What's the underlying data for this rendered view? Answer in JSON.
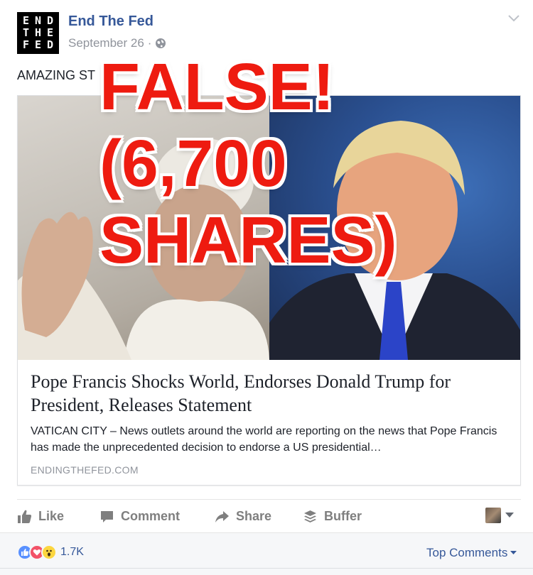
{
  "page": {
    "logo_letters": [
      "E",
      "N",
      "D",
      "T",
      "H",
      "E",
      "F",
      "E",
      "D"
    ],
    "name": "End The Fed",
    "date": "September 26",
    "separator": "·"
  },
  "post": {
    "text": "AMAZING ST"
  },
  "link_card": {
    "headline": "Pope Francis Shocks World, Endorses Donald Trump for President, Releases Statement",
    "description": "VATICAN CITY – News outlets around the world are reporting on the news that Pope Francis has made the unprecedented decision to endorse a US presidential…",
    "domain": "ENDINGTHEFED.COM"
  },
  "overlay": {
    "line1": "FALSE!",
    "line2": "(6,700",
    "line3": "SHARES)",
    "color": "#ee1b10"
  },
  "actions": {
    "like": "Like",
    "comment": "Comment",
    "share": "Share",
    "buffer": "Buffer"
  },
  "footer": {
    "reactions": [
      "like-icon",
      "love-icon",
      "wow-icon"
    ],
    "reaction_count": "1.7K",
    "sort_label": "Top Comments"
  },
  "colors": {
    "link_blue": "#365899",
    "meta_gray": "#90949c",
    "action_gray": "#7f7f7f"
  }
}
